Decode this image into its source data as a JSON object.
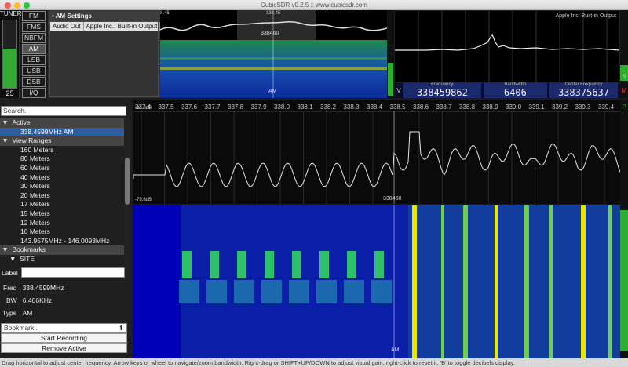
{
  "window": {
    "title": "CubicSDR v0.2.5 :: www.cubicsdr.com"
  },
  "tuner": {
    "label": "TUNER",
    "value": "25",
    "level": 0.58
  },
  "modes": [
    "FM",
    "FMS",
    "NBFM",
    "AM",
    "LSB",
    "USB",
    "DSB",
    "I/Q"
  ],
  "selected_mode": "AM",
  "am_settings": {
    "title": "AM Settings",
    "tab1": "Audio Out",
    "tab2": "Apple Inc.: Built-in Output"
  },
  "top_waterfall": {
    "freq_label": "338460",
    "mode": "AM",
    "left_label": "8.45",
    "top_label": "338.45"
  },
  "scope": {
    "caption": "Apple Inc. Built-in Output"
  },
  "readouts": {
    "v_label": "V",
    "frequency_label": "Frequency",
    "frequency": "338459862",
    "bandwidth_label": "Bandwidth",
    "bandwidth": "6406",
    "center_label": "Center Frequency",
    "center": "338375637"
  },
  "right_buttons": {
    "s": "S",
    "m": "M",
    "p": "P"
  },
  "search": {
    "placeholder": "Search.."
  },
  "tree": {
    "active_header": "Active",
    "active_item": "338.4599MHz AM",
    "ranges_header": "View Ranges",
    "ranges": [
      "160 Meters",
      "80 Meters",
      "60 Meters",
      "40 Meters",
      "30 Meters",
      "20 Meters",
      "17 Meters",
      "15 Meters",
      "12 Meters",
      "10 Meters",
      "143.9575MHz - 146.0093MHz"
    ],
    "bookmarks_header": "Bookmarks",
    "site": "SITE"
  },
  "form": {
    "label": "Label",
    "freq_label": "Freq",
    "freq": "338.4599MHz",
    "bw_label": "BW",
    "bw": "6.406KHz",
    "type_label": "Type",
    "type": "AM"
  },
  "bookmark_select": "Bookmark..",
  "buttons": {
    "start_recording": "Start Recording",
    "remove_active": "Remove Active"
  },
  "spectrum": {
    "db_top": "-31.8dB",
    "db_bottom": "-79.8dB",
    "ticks": [
      "337.4",
      "337.5",
      "337.6",
      "337.7",
      "337.8",
      "337.9",
      "338.0",
      "338.1",
      "338.2",
      "338.3",
      "338.4",
      "338.5",
      "338.6",
      "338.7",
      "338.8",
      "338.9",
      "339.0",
      "339.1",
      "339.2",
      "339.3",
      "339.4"
    ],
    "center_label": "338460"
  },
  "waterfall": {
    "mode": "AM"
  },
  "status_text": "Drag horizontal to adjust center frequency. Arrow keys or wheel to navigate/zoom bandwidth. Right-drag or SHIFT+UP/DOWN to adjust visual gain, right-click to reset it. 'B' to toggle decibels display.",
  "colors": {
    "accent_green": "#33a833",
    "waterfall_blue": "#0000c0",
    "waterfall_yellow": "#e6e600",
    "selected_blue": "#2d5d9f"
  }
}
